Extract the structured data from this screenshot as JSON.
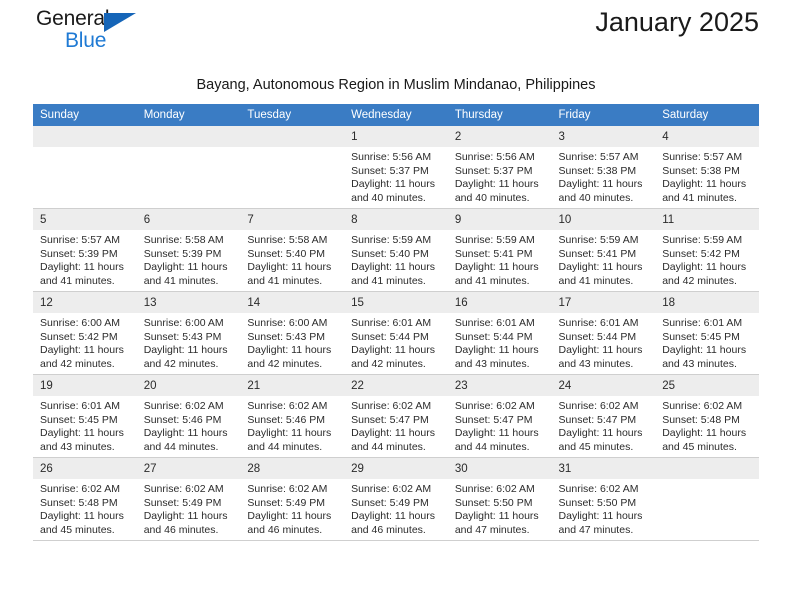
{
  "logo": {
    "word_one": "General",
    "word_two": "Blue",
    "triangle_color": "#1565b8",
    "blue_color": "#1f7ad4"
  },
  "header": {
    "title": "January 2025",
    "subtitle": "Bayang, Autonomous Region in Muslim Mindanao, Philippines",
    "accent_color": "#3a7cc4"
  },
  "calendar": {
    "weekday_headers": [
      "Sunday",
      "Monday",
      "Tuesday",
      "Wednesday",
      "Thursday",
      "Friday",
      "Saturday"
    ],
    "labels": {
      "sunrise": "Sunrise:",
      "sunset": "Sunset:",
      "daylight": "Daylight:"
    },
    "weeks": [
      [
        {
          "day": "",
          "empty": true
        },
        {
          "day": "",
          "empty": true
        },
        {
          "day": "",
          "empty": true
        },
        {
          "day": "1",
          "sunrise": "Sunrise: 5:56 AM",
          "sunset": "Sunset: 5:37 PM",
          "daylight": "Daylight: 11 hours and 40 minutes."
        },
        {
          "day": "2",
          "sunrise": "Sunrise: 5:56 AM",
          "sunset": "Sunset: 5:37 PM",
          "daylight": "Daylight: 11 hours and 40 minutes."
        },
        {
          "day": "3",
          "sunrise": "Sunrise: 5:57 AM",
          "sunset": "Sunset: 5:38 PM",
          "daylight": "Daylight: 11 hours and 40 minutes."
        },
        {
          "day": "4",
          "sunrise": "Sunrise: 5:57 AM",
          "sunset": "Sunset: 5:38 PM",
          "daylight": "Daylight: 11 hours and 41 minutes."
        }
      ],
      [
        {
          "day": "5",
          "sunrise": "Sunrise: 5:57 AM",
          "sunset": "Sunset: 5:39 PM",
          "daylight": "Daylight: 11 hours and 41 minutes."
        },
        {
          "day": "6",
          "sunrise": "Sunrise: 5:58 AM",
          "sunset": "Sunset: 5:39 PM",
          "daylight": "Daylight: 11 hours and 41 minutes."
        },
        {
          "day": "7",
          "sunrise": "Sunrise: 5:58 AM",
          "sunset": "Sunset: 5:40 PM",
          "daylight": "Daylight: 11 hours and 41 minutes."
        },
        {
          "day": "8",
          "sunrise": "Sunrise: 5:59 AM",
          "sunset": "Sunset: 5:40 PM",
          "daylight": "Daylight: 11 hours and 41 minutes."
        },
        {
          "day": "9",
          "sunrise": "Sunrise: 5:59 AM",
          "sunset": "Sunset: 5:41 PM",
          "daylight": "Daylight: 11 hours and 41 minutes."
        },
        {
          "day": "10",
          "sunrise": "Sunrise: 5:59 AM",
          "sunset": "Sunset: 5:41 PM",
          "daylight": "Daylight: 11 hours and 41 minutes."
        },
        {
          "day": "11",
          "sunrise": "Sunrise: 5:59 AM",
          "sunset": "Sunset: 5:42 PM",
          "daylight": "Daylight: 11 hours and 42 minutes."
        }
      ],
      [
        {
          "day": "12",
          "sunrise": "Sunrise: 6:00 AM",
          "sunset": "Sunset: 5:42 PM",
          "daylight": "Daylight: 11 hours and 42 minutes."
        },
        {
          "day": "13",
          "sunrise": "Sunrise: 6:00 AM",
          "sunset": "Sunset: 5:43 PM",
          "daylight": "Daylight: 11 hours and 42 minutes."
        },
        {
          "day": "14",
          "sunrise": "Sunrise: 6:00 AM",
          "sunset": "Sunset: 5:43 PM",
          "daylight": "Daylight: 11 hours and 42 minutes."
        },
        {
          "day": "15",
          "sunrise": "Sunrise: 6:01 AM",
          "sunset": "Sunset: 5:44 PM",
          "daylight": "Daylight: 11 hours and 42 minutes."
        },
        {
          "day": "16",
          "sunrise": "Sunrise: 6:01 AM",
          "sunset": "Sunset: 5:44 PM",
          "daylight": "Daylight: 11 hours and 43 minutes."
        },
        {
          "day": "17",
          "sunrise": "Sunrise: 6:01 AM",
          "sunset": "Sunset: 5:44 PM",
          "daylight": "Daylight: 11 hours and 43 minutes."
        },
        {
          "day": "18",
          "sunrise": "Sunrise: 6:01 AM",
          "sunset": "Sunset: 5:45 PM",
          "daylight": "Daylight: 11 hours and 43 minutes."
        }
      ],
      [
        {
          "day": "19",
          "sunrise": "Sunrise: 6:01 AM",
          "sunset": "Sunset: 5:45 PM",
          "daylight": "Daylight: 11 hours and 43 minutes."
        },
        {
          "day": "20",
          "sunrise": "Sunrise: 6:02 AM",
          "sunset": "Sunset: 5:46 PM",
          "daylight": "Daylight: 11 hours and 44 minutes."
        },
        {
          "day": "21",
          "sunrise": "Sunrise: 6:02 AM",
          "sunset": "Sunset: 5:46 PM",
          "daylight": "Daylight: 11 hours and 44 minutes."
        },
        {
          "day": "22",
          "sunrise": "Sunrise: 6:02 AM",
          "sunset": "Sunset: 5:47 PM",
          "daylight": "Daylight: 11 hours and 44 minutes."
        },
        {
          "day": "23",
          "sunrise": "Sunrise: 6:02 AM",
          "sunset": "Sunset: 5:47 PM",
          "daylight": "Daylight: 11 hours and 44 minutes."
        },
        {
          "day": "24",
          "sunrise": "Sunrise: 6:02 AM",
          "sunset": "Sunset: 5:47 PM",
          "daylight": "Daylight: 11 hours and 45 minutes."
        },
        {
          "day": "25",
          "sunrise": "Sunrise: 6:02 AM",
          "sunset": "Sunset: 5:48 PM",
          "daylight": "Daylight: 11 hours and 45 minutes."
        }
      ],
      [
        {
          "day": "26",
          "sunrise": "Sunrise: 6:02 AM",
          "sunset": "Sunset: 5:48 PM",
          "daylight": "Daylight: 11 hours and 45 minutes."
        },
        {
          "day": "27",
          "sunrise": "Sunrise: 6:02 AM",
          "sunset": "Sunset: 5:49 PM",
          "daylight": "Daylight: 11 hours and 46 minutes."
        },
        {
          "day": "28",
          "sunrise": "Sunrise: 6:02 AM",
          "sunset": "Sunset: 5:49 PM",
          "daylight": "Daylight: 11 hours and 46 minutes."
        },
        {
          "day": "29",
          "sunrise": "Sunrise: 6:02 AM",
          "sunset": "Sunset: 5:49 PM",
          "daylight": "Daylight: 11 hours and 46 minutes."
        },
        {
          "day": "30",
          "sunrise": "Sunrise: 6:02 AM",
          "sunset": "Sunset: 5:50 PM",
          "daylight": "Daylight: 11 hours and 47 minutes."
        },
        {
          "day": "31",
          "sunrise": "Sunrise: 6:02 AM",
          "sunset": "Sunset: 5:50 PM",
          "daylight": "Daylight: 11 hours and 47 minutes."
        },
        {
          "day": "",
          "empty": true
        }
      ]
    ]
  }
}
